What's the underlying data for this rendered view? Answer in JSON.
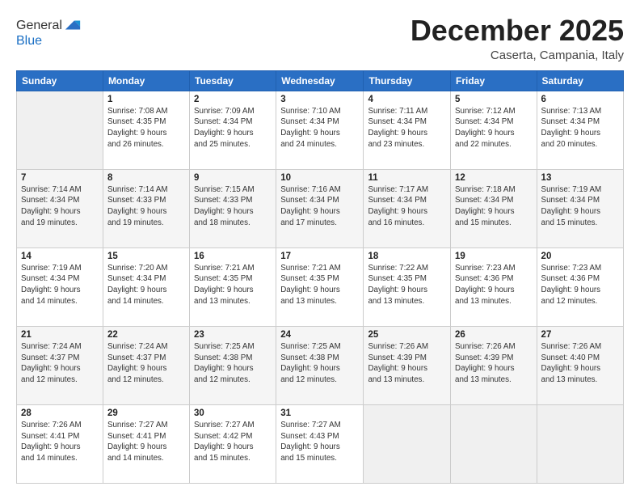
{
  "header": {
    "logo": {
      "line1": "General",
      "line2": "Blue"
    },
    "title": "December 2025",
    "subtitle": "Caserta, Campania, Italy"
  },
  "weekdays": [
    "Sunday",
    "Monday",
    "Tuesday",
    "Wednesday",
    "Thursday",
    "Friday",
    "Saturday"
  ],
  "weeks": [
    [
      {
        "day": "",
        "info": ""
      },
      {
        "day": "1",
        "info": "Sunrise: 7:08 AM\nSunset: 4:35 PM\nDaylight: 9 hours\nand 26 minutes."
      },
      {
        "day": "2",
        "info": "Sunrise: 7:09 AM\nSunset: 4:34 PM\nDaylight: 9 hours\nand 25 minutes."
      },
      {
        "day": "3",
        "info": "Sunrise: 7:10 AM\nSunset: 4:34 PM\nDaylight: 9 hours\nand 24 minutes."
      },
      {
        "day": "4",
        "info": "Sunrise: 7:11 AM\nSunset: 4:34 PM\nDaylight: 9 hours\nand 23 minutes."
      },
      {
        "day": "5",
        "info": "Sunrise: 7:12 AM\nSunset: 4:34 PM\nDaylight: 9 hours\nand 22 minutes."
      },
      {
        "day": "6",
        "info": "Sunrise: 7:13 AM\nSunset: 4:34 PM\nDaylight: 9 hours\nand 20 minutes."
      }
    ],
    [
      {
        "day": "7",
        "info": "Sunrise: 7:14 AM\nSunset: 4:34 PM\nDaylight: 9 hours\nand 19 minutes."
      },
      {
        "day": "8",
        "info": "Sunrise: 7:14 AM\nSunset: 4:33 PM\nDaylight: 9 hours\nand 19 minutes."
      },
      {
        "day": "9",
        "info": "Sunrise: 7:15 AM\nSunset: 4:33 PM\nDaylight: 9 hours\nand 18 minutes."
      },
      {
        "day": "10",
        "info": "Sunrise: 7:16 AM\nSunset: 4:34 PM\nDaylight: 9 hours\nand 17 minutes."
      },
      {
        "day": "11",
        "info": "Sunrise: 7:17 AM\nSunset: 4:34 PM\nDaylight: 9 hours\nand 16 minutes."
      },
      {
        "day": "12",
        "info": "Sunrise: 7:18 AM\nSunset: 4:34 PM\nDaylight: 9 hours\nand 15 minutes."
      },
      {
        "day": "13",
        "info": "Sunrise: 7:19 AM\nSunset: 4:34 PM\nDaylight: 9 hours\nand 15 minutes."
      }
    ],
    [
      {
        "day": "14",
        "info": "Sunrise: 7:19 AM\nSunset: 4:34 PM\nDaylight: 9 hours\nand 14 minutes."
      },
      {
        "day": "15",
        "info": "Sunrise: 7:20 AM\nSunset: 4:34 PM\nDaylight: 9 hours\nand 14 minutes."
      },
      {
        "day": "16",
        "info": "Sunrise: 7:21 AM\nSunset: 4:35 PM\nDaylight: 9 hours\nand 13 minutes."
      },
      {
        "day": "17",
        "info": "Sunrise: 7:21 AM\nSunset: 4:35 PM\nDaylight: 9 hours\nand 13 minutes."
      },
      {
        "day": "18",
        "info": "Sunrise: 7:22 AM\nSunset: 4:35 PM\nDaylight: 9 hours\nand 13 minutes."
      },
      {
        "day": "19",
        "info": "Sunrise: 7:23 AM\nSunset: 4:36 PM\nDaylight: 9 hours\nand 13 minutes."
      },
      {
        "day": "20",
        "info": "Sunrise: 7:23 AM\nSunset: 4:36 PM\nDaylight: 9 hours\nand 12 minutes."
      }
    ],
    [
      {
        "day": "21",
        "info": "Sunrise: 7:24 AM\nSunset: 4:37 PM\nDaylight: 9 hours\nand 12 minutes."
      },
      {
        "day": "22",
        "info": "Sunrise: 7:24 AM\nSunset: 4:37 PM\nDaylight: 9 hours\nand 12 minutes."
      },
      {
        "day": "23",
        "info": "Sunrise: 7:25 AM\nSunset: 4:38 PM\nDaylight: 9 hours\nand 12 minutes."
      },
      {
        "day": "24",
        "info": "Sunrise: 7:25 AM\nSunset: 4:38 PM\nDaylight: 9 hours\nand 12 minutes."
      },
      {
        "day": "25",
        "info": "Sunrise: 7:26 AM\nSunset: 4:39 PM\nDaylight: 9 hours\nand 13 minutes."
      },
      {
        "day": "26",
        "info": "Sunrise: 7:26 AM\nSunset: 4:39 PM\nDaylight: 9 hours\nand 13 minutes."
      },
      {
        "day": "27",
        "info": "Sunrise: 7:26 AM\nSunset: 4:40 PM\nDaylight: 9 hours\nand 13 minutes."
      }
    ],
    [
      {
        "day": "28",
        "info": "Sunrise: 7:26 AM\nSunset: 4:41 PM\nDaylight: 9 hours\nand 14 minutes."
      },
      {
        "day": "29",
        "info": "Sunrise: 7:27 AM\nSunset: 4:41 PM\nDaylight: 9 hours\nand 14 minutes."
      },
      {
        "day": "30",
        "info": "Sunrise: 7:27 AM\nSunset: 4:42 PM\nDaylight: 9 hours\nand 15 minutes."
      },
      {
        "day": "31",
        "info": "Sunrise: 7:27 AM\nSunset: 4:43 PM\nDaylight: 9 hours\nand 15 minutes."
      },
      {
        "day": "",
        "info": ""
      },
      {
        "day": "",
        "info": ""
      },
      {
        "day": "",
        "info": ""
      }
    ]
  ]
}
